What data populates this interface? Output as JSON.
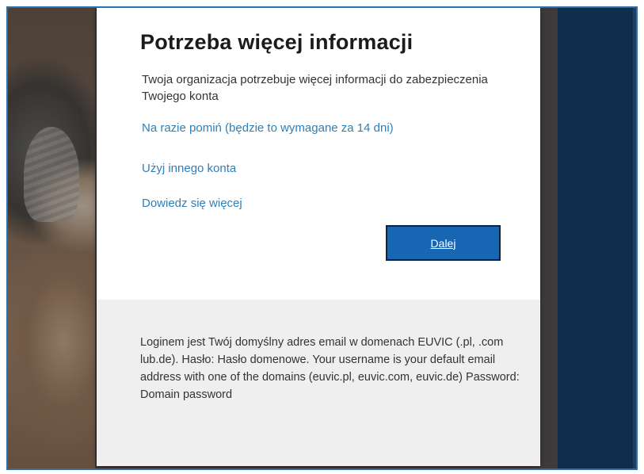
{
  "dialog": {
    "title": "Potrzeba więcej informacji",
    "description": "Twoja organizacja potrzebuje więcej informacji do zabezpieczenia Twojego konta",
    "links": {
      "skip": "Na razie pomiń (będzie to wymagane za 14 dni)",
      "other_account": "Użyj innego konta",
      "learn_more": "Dowiedz się więcej"
    },
    "next_button": "Dalej",
    "footer_text": "Loginem jest Twój domyślny adres email w domenach EUVIC (.pl, .com lub.de). Hasło: Hasło domenowe. Your username is your default email address with one of the domains (euvic.pl, euvic.com, euvic.de) Password: Domain password"
  },
  "colors": {
    "link": "#2f7fb8",
    "button": "#1666b4",
    "right_panel": "#0f2e4e",
    "footer_bg": "#efefef"
  }
}
